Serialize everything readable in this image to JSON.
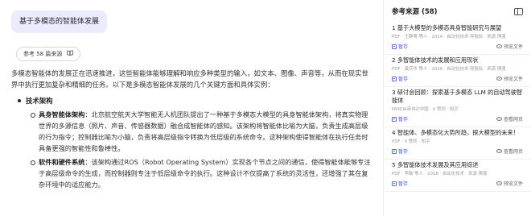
{
  "query": "基于多模态的智能体发展",
  "refs_pill": "参考 58 篇来源",
  "answer": {
    "intro": "多模态智能体的发展正在迅速推进，这些智能体能够理解和响应多种类型的输入，如文本、图像、声音等，从而在现实世界中执行更加复杂和精细的任务。以下是多模态智能体发展的几个关键方面和具体实例：",
    "section1_title": "技术架构",
    "sub1_label": "具身智能体架构",
    "sub1_text": "：北京航空航天大学智能无人机团队提出了一种基于多模态大模型的具身智能体架构，将真实物理世界的多源信息（照片、声音、传感器数据）融合成智能体的感知。该架构将智能体比喻为大脑，负责生成高层级的行为指令；控制器比喻为小脑，负责将高层级指令转换为低层级的系统命令。这种架构使得智能体在执行任务时具备更强的智能性和鲁棒性。",
    "sub2_label": "软件和硬件系统",
    "sub2_text": "：该架构通过ROS（Robot Operating System）实现各个节点之间的通信，使得智能体能够专注于高层级命令的生成，而控制器则专注于低层级命令的执行。这种设计不仅提高了系统的灵活性，还增强了其在复杂环境中的适应能力。"
  },
  "panel": {
    "title": "参考来源 (58)",
    "items": [
      {
        "title": "1 基于大模型的多模态具身智能研究与展望",
        "meta": "PDF · 王群博 等人 · 2024 · 自动化技术·导航轨 · 来源 博渡",
        "save": "暂存",
        "view": "预览文件"
      },
      {
        "title": "2 多智能体技术的发展和应用现状",
        "meta": "PDF · 袁庆华 等人 · 2016 · 自动化技术·导航轨 · 来源 博渡",
        "save": "暂存",
        "view": "预览文件"
      },
      {
        "title": "3 研讨会回顾：探索基于多模态 LLM 的自动驾驶智能体",
        "meta": "NVIDIA英伟达中国 · 0 赞同 · 知乎",
        "save": "暂存",
        "view": "查看网页"
      },
      {
        "title": "4 智能体、多模态化大势所趋，探大模型的未来！",
        "meta": "PDF · 0 赞同 · 知乎",
        "save": "暂存",
        "view": "查看网页"
      },
      {
        "title": "5 多智能体技术发展及其应用综述",
        "meta": "PDF · 李敏 等人 · 2018 · 自动化技术 · 来源 博渡",
        "save": "暂存",
        "view": "预览文件"
      }
    ]
  }
}
